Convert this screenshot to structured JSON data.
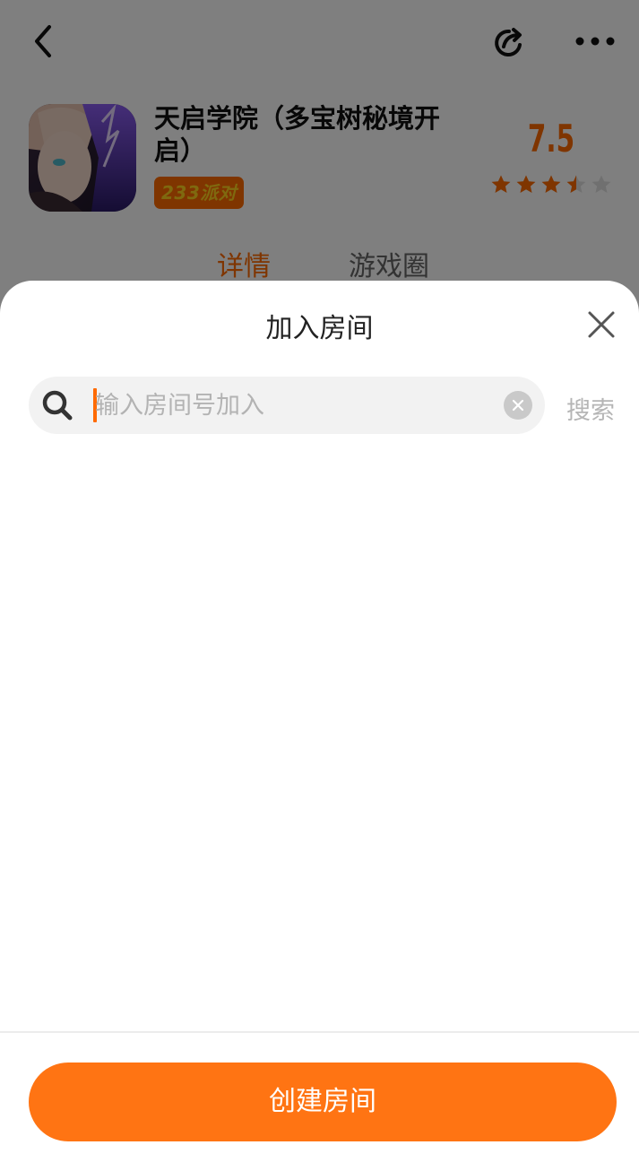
{
  "header": {
    "back_icon": "chevron-left-icon",
    "share_icon": "share-icon",
    "more_icon": "more-dots-icon"
  },
  "game": {
    "title": "天启学院（多宝树秘境开启）",
    "badge": "233派对",
    "score": "7.5",
    "rating_stars": 3.5,
    "max_stars": 5
  },
  "tabs": [
    {
      "label": "详情",
      "active": true
    },
    {
      "label": "游戏圈",
      "active": false
    }
  ],
  "dialog": {
    "title": "加入房间",
    "search": {
      "value": "",
      "placeholder": "输入房间号加入"
    },
    "search_action_label": "搜索",
    "create_button_label": "创建房间"
  },
  "colors": {
    "accent": "#ff6a00",
    "button": "#ff7413",
    "overlay": "rgba(0,0,0,0.5)"
  }
}
